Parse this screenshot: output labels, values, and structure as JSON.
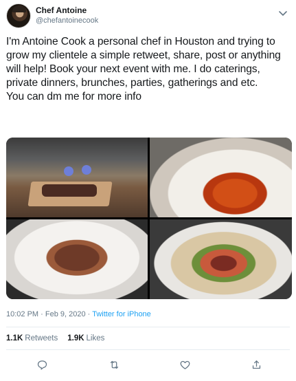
{
  "author": {
    "name": "Chef Antoine",
    "handle": "@chefantoinecook"
  },
  "tweet": {
    "text_lines": [
      "I'm Antoine Cook a personal chef in Houston and trying to grow my clientele a simple retweet, share, post or anything will help! Book your next event with me. I do caterings, private dinners, brunches, parties, gatherings and etc.",
      "You can dm me for more info"
    ]
  },
  "media": [
    {
      "name": "photo-chef-carving-meat"
    },
    {
      "name": "photo-lobster-tail-plate"
    },
    {
      "name": "photo-lamb-chops-potatoes"
    },
    {
      "name": "photo-steak-rice-bowl"
    }
  ],
  "meta": {
    "time": "10:02 PM",
    "separator": "·",
    "date": "Feb 9, 2020",
    "source": "Twitter for iPhone"
  },
  "stats": {
    "retweets_count": "1.1K",
    "retweets_label": "Retweets",
    "likes_count": "1.9K",
    "likes_label": "Likes"
  },
  "icons": [
    "chevron-down-icon",
    "reply-icon",
    "retweet-icon",
    "like-icon",
    "share-icon"
  ],
  "colors": {
    "text": "#14171a",
    "secondary": "#657786",
    "link": "#1da1f2",
    "divider": "#e6ecf0"
  }
}
